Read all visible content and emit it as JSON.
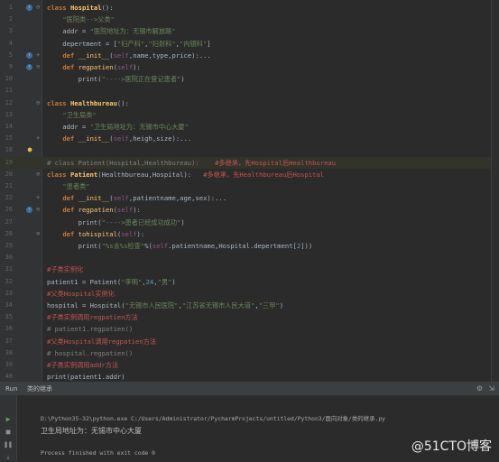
{
  "editor": {
    "lines": [
      {
        "n": "1",
        "fold": "⊖",
        "mark": "ovr",
        "segs": [
          [
            "kw",
            "class "
          ],
          [
            "cls",
            "Hospital"
          ],
          [
            "",
            "():"
          ]
        ]
      },
      {
        "n": "2",
        "segs": [
          [
            "",
            "    "
          ],
          [
            "str",
            "\"医院类-->父类\""
          ]
        ]
      },
      {
        "n": "3",
        "segs": [
          [
            "",
            "    addr = "
          ],
          [
            "str",
            "\"医院地址为：无锡市解放路\""
          ]
        ]
      },
      {
        "n": "4",
        "segs": [
          [
            "",
            "    depertment = ["
          ],
          [
            "str",
            "\"妇产科\""
          ],
          [
            "",
            ","
          ],
          [
            "str",
            "\"妇射科\""
          ],
          [
            "",
            ","
          ],
          [
            "str",
            "\"内镜科\""
          ],
          [
            "",
            "]"
          ]
        ]
      },
      {
        "n": "5",
        "fold": "+",
        "mark": "ovr",
        "segs": [
          [
            "",
            "    "
          ],
          [
            "kw",
            "def "
          ],
          [
            "fn",
            "__init__"
          ],
          [
            "",
            "("
          ],
          [
            "self",
            "self"
          ],
          [
            "",
            ",name,type,price):..."
          ]
        ]
      },
      {
        "n": "9",
        "fold": "⊖",
        "mark": "ovr",
        "segs": [
          [
            "",
            "    "
          ],
          [
            "kw",
            "def "
          ],
          [
            "fn",
            "regpatien"
          ],
          [
            "",
            "("
          ],
          [
            "self",
            "self"
          ],
          [
            "",
            "):"
          ]
        ]
      },
      {
        "n": "10",
        "segs": [
          [
            "",
            "        print("
          ],
          [
            "str",
            "\"---->医院正在登记患者\""
          ],
          [
            "",
            ")"
          ]
        ]
      },
      {
        "n": "11",
        "segs": [
          [
            "",
            ""
          ]
        ]
      },
      {
        "n": "12",
        "fold": "⊖",
        "segs": [
          [
            "kw",
            "class "
          ],
          [
            "cls",
            "Healthbureau"
          ],
          [
            "",
            "():"
          ]
        ]
      },
      {
        "n": "13",
        "segs": [
          [
            "",
            "    "
          ],
          [
            "str",
            "\"卫生局类\""
          ]
        ]
      },
      {
        "n": "14",
        "segs": [
          [
            "",
            "    addr = "
          ],
          [
            "str",
            "\"卫生局地址为：无锡市中心大厦\""
          ]
        ]
      },
      {
        "n": "15",
        "fold": "+",
        "segs": [
          [
            "",
            "    "
          ],
          [
            "kw",
            "def "
          ],
          [
            "fn",
            "__init__"
          ],
          [
            "",
            "("
          ],
          [
            "self",
            "self"
          ],
          [
            "",
            ",heigh,size):..."
          ]
        ]
      },
      {
        "n": "18",
        "mark": "bulb",
        "segs": [
          [
            "",
            ""
          ]
        ]
      },
      {
        "n": "19",
        "hl": true,
        "segs": [
          [
            "cm",
            "# class Patient(Hospital,Healthbureau):"
          ],
          [
            "",
            ""
          ],
          [
            "cmr",
            "    #多继承，先Hospital后Healthbureau"
          ]
        ]
      },
      {
        "n": "20",
        "fold": "⊖",
        "segs": [
          [
            "kw",
            "class "
          ],
          [
            "cls",
            "Patient"
          ],
          [
            "",
            "(Healthbureau,Hospital):"
          ],
          [
            "cmr",
            "   #多继承，先Healthbureau后Hospital"
          ]
        ]
      },
      {
        "n": "21",
        "segs": [
          [
            "",
            "    "
          ],
          [
            "str",
            "\"患者类\""
          ]
        ]
      },
      {
        "n": "22",
        "fold": "+",
        "segs": [
          [
            "",
            "    "
          ],
          [
            "kw",
            "def "
          ],
          [
            "fn",
            "__init__"
          ],
          [
            "",
            "("
          ],
          [
            "self",
            "self"
          ],
          [
            "",
            ",patientname,age,sex):..."
          ]
        ]
      },
      {
        "n": "26",
        "fold": "⊖",
        "mark": "ovr",
        "segs": [
          [
            "",
            "    "
          ],
          [
            "kw",
            "def "
          ],
          [
            "fn",
            "regpatien"
          ],
          [
            "",
            "("
          ],
          [
            "self",
            "self"
          ],
          [
            "",
            "):"
          ]
        ]
      },
      {
        "n": "27",
        "segs": [
          [
            "",
            "        print("
          ],
          [
            "str",
            "\"---->患者已经成功成功\""
          ],
          [
            "",
            ")"
          ]
        ]
      },
      {
        "n": "28",
        "fold": "⊖",
        "segs": [
          [
            "",
            "    "
          ],
          [
            "kw",
            "def "
          ],
          [
            "fn",
            "tohispital"
          ],
          [
            "",
            "("
          ],
          [
            "self",
            "self"
          ],
          [
            "",
            "):"
          ]
        ]
      },
      {
        "n": "29",
        "segs": [
          [
            "",
            "        print("
          ],
          [
            "str",
            "\"%s去%s检查\""
          ],
          [
            "",
            "%("
          ],
          [
            "self",
            "self"
          ],
          [
            "",
            ".patientname,Hospital.depertment["
          ],
          [
            "num",
            "2"
          ],
          [
            "",
            "]))"
          ]
        ]
      },
      {
        "n": "30",
        "segs": [
          [
            "",
            ""
          ]
        ]
      },
      {
        "n": "31",
        "segs": [
          [
            "cmr",
            "#子类实例化"
          ]
        ]
      },
      {
        "n": "32",
        "segs": [
          [
            "",
            "patient1 = Patient("
          ],
          [
            "str",
            "\"李明\""
          ],
          [
            "",
            ","
          ],
          [
            "num",
            "24"
          ],
          [
            "",
            ","
          ],
          [
            "str",
            "\"男\""
          ],
          [
            "",
            ")"
          ]
        ]
      },
      {
        "n": "33",
        "segs": [
          [
            "cmr",
            "#父类Hospital实例化"
          ]
        ]
      },
      {
        "n": "34",
        "segs": [
          [
            "",
            "hospital = Hospital("
          ],
          [
            "str",
            "\"无锡市人民医院\""
          ],
          [
            "",
            ","
          ],
          [
            "str",
            "\"江苏省无锡市人民大道\""
          ],
          [
            "",
            ","
          ],
          [
            "str",
            "\"三甲\""
          ],
          [
            "",
            ")"
          ]
        ]
      },
      {
        "n": "35",
        "segs": [
          [
            "cmr",
            "#子类实例调用regpatien方法"
          ]
        ]
      },
      {
        "n": "36",
        "segs": [
          [
            "cm",
            "# patient1.regpatien()"
          ]
        ]
      },
      {
        "n": "37",
        "segs": [
          [
            "cmr",
            "#父类Hospital调用regpatien方法"
          ]
        ]
      },
      {
        "n": "38",
        "segs": [
          [
            "cm",
            "# hospital.regpatien()"
          ]
        ]
      },
      {
        "n": "39",
        "segs": [
          [
            "cmr",
            "#子类实例调用addr方法"
          ]
        ]
      },
      {
        "n": "40",
        "segs": [
          [
            "",
            "print(patient1.addr)"
          ]
        ]
      }
    ]
  },
  "run": {
    "label": "Run",
    "tab": "类的继承",
    "command": "D:\\Python35-32\\python.exe C:/Users/Administrator/PycharmProjects/untitled/Python3/面向对象/类的继承.py",
    "result": "卫生局地址为：无锡市中心大厦",
    "finished": "Process finished with exit code 0"
  },
  "watermark": "@51CTO博客"
}
